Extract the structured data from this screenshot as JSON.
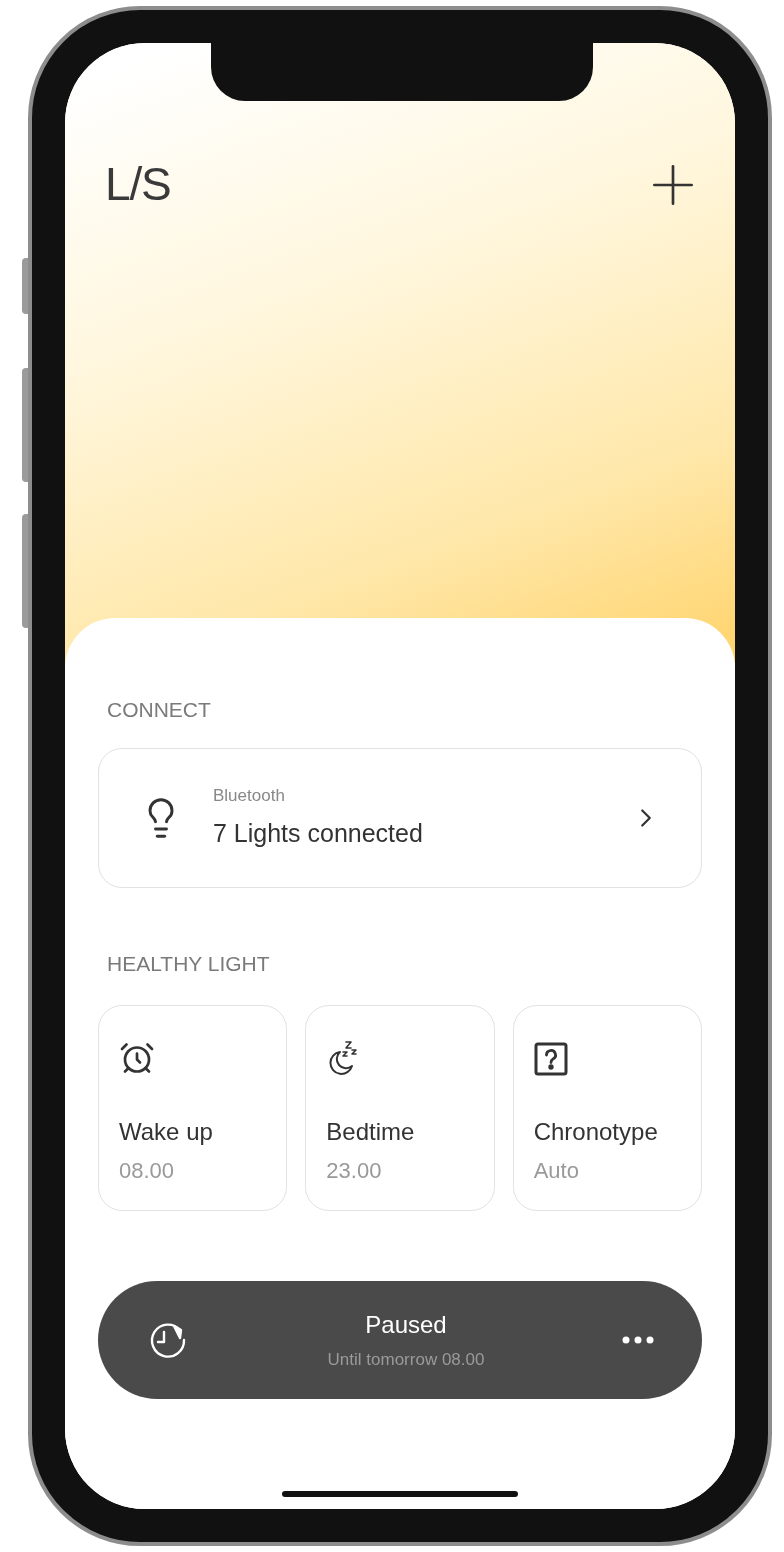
{
  "header": {
    "logo": "L/S"
  },
  "connect": {
    "heading": "CONNECT",
    "card": {
      "subtitle": "Bluetooth",
      "title": "7 Lights connected"
    }
  },
  "healthy_light": {
    "heading": "HEALTHY LIGHT",
    "cards": [
      {
        "kind": "alarm",
        "title": "Wake up",
        "value": "08.00"
      },
      {
        "kind": "sleep",
        "title": "Bedtime",
        "value": "23.00"
      },
      {
        "kind": "question",
        "title": "Chronotype",
        "value": "Auto"
      }
    ]
  },
  "status_bar": {
    "title": "Paused",
    "subtitle": "Until tomorrow 08.00"
  }
}
